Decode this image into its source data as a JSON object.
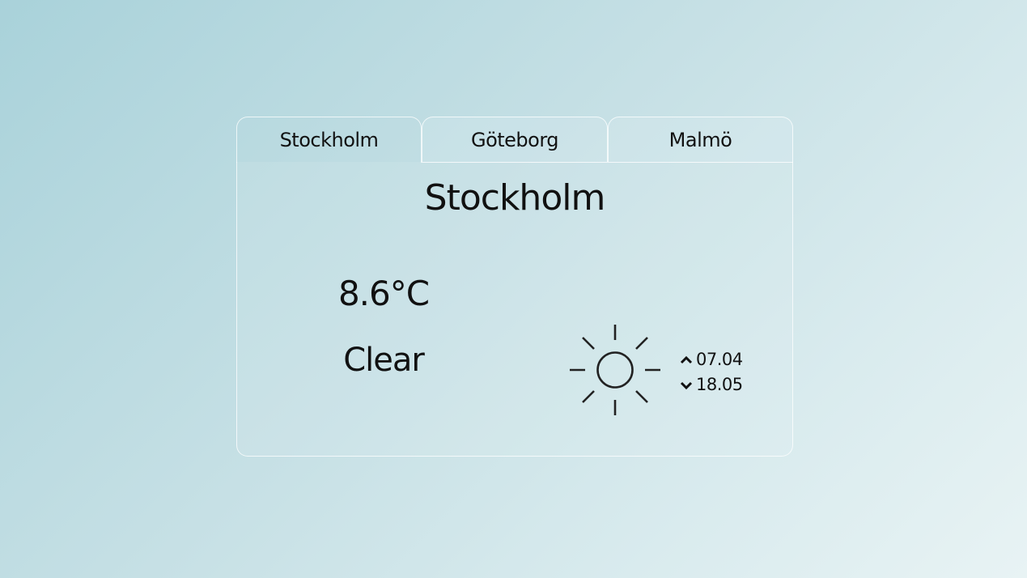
{
  "tabs": [
    {
      "label": "Stockholm",
      "active": true
    },
    {
      "label": "Göteborg",
      "active": false
    },
    {
      "label": "Malmö",
      "active": false
    }
  ],
  "weather": {
    "city": "Stockholm",
    "temperature": "8.6°C",
    "condition": "Clear",
    "icon": "sun-icon",
    "sunrise": "07.04",
    "sunset": "18.05"
  }
}
